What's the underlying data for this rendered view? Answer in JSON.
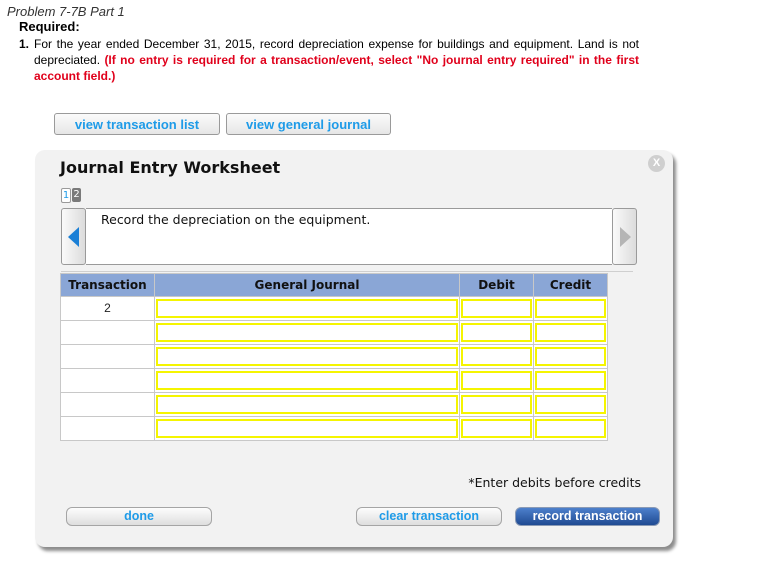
{
  "header": {
    "problem_title": "Problem 7-7B Part 1",
    "required_label": "Required:",
    "item_number": "1.",
    "item_text": "For the year ended December 31, 2015, record depreciation expense for buildings and equipment. Land is not depreciated.",
    "item_instruction": "(If no entry is required for a transaction/event, select \"No journal entry required\" in the first account field.)"
  },
  "toolbar": {
    "view_transaction_list": "view transaction list",
    "view_general_journal": "view general journal"
  },
  "worksheet": {
    "title": "Journal Entry Worksheet",
    "close_label": "X",
    "pages": [
      "1",
      "2"
    ],
    "current_page": 2,
    "description": "Record the depreciation on the equipment.",
    "columns": [
      "Transaction",
      "General Journal",
      "Debit",
      "Credit"
    ],
    "rows": [
      {
        "transaction": "2",
        "account": "",
        "debit": "",
        "credit": ""
      },
      {
        "transaction": "",
        "account": "",
        "debit": "",
        "credit": ""
      },
      {
        "transaction": "",
        "account": "",
        "debit": "",
        "credit": ""
      },
      {
        "transaction": "",
        "account": "",
        "debit": "",
        "credit": ""
      },
      {
        "transaction": "",
        "account": "",
        "debit": "",
        "credit": ""
      },
      {
        "transaction": "",
        "account": "",
        "debit": "",
        "credit": ""
      }
    ],
    "footnote": "*Enter debits before credits",
    "buttons": {
      "done": "done",
      "clear": "clear transaction",
      "record": "record transaction"
    }
  },
  "colors": {
    "accent_blue": "#1e9be8",
    "instruction_red": "#e0001b",
    "header_blue": "#8aa6d6",
    "input_highlight": "#f5f500",
    "record_button": "#1f4a92"
  }
}
